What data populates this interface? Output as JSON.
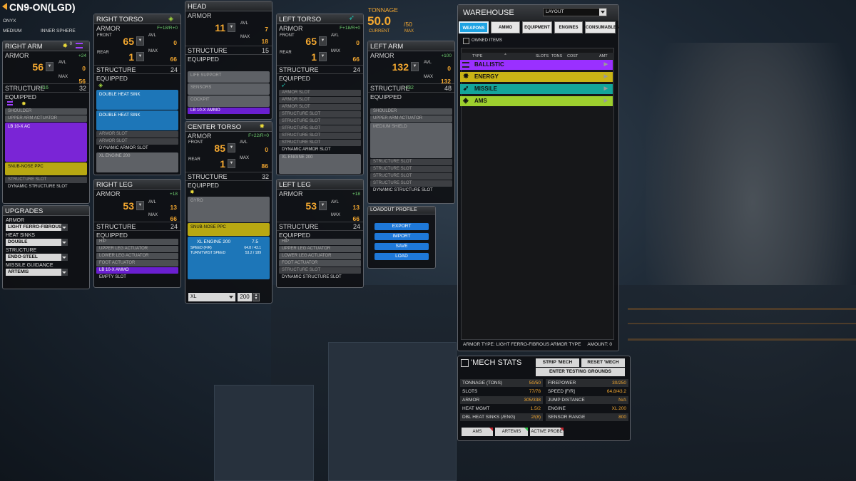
{
  "mech": {
    "name": "CN9-ON(LGD)",
    "variant": "ONYX",
    "weight_class": "MEDIUM",
    "faction": "INNER SPHERE"
  },
  "tonnage": {
    "label": "TONNAGE",
    "current": "50.0",
    "max": "/50",
    "current_label": "CURRENT",
    "max_label": "MAX"
  },
  "labels": {
    "armor": "ARMOR",
    "avl": "AVL",
    "max": "MAX",
    "structure": "STRUCTURE",
    "equipped": "EQUIPPED",
    "front": "FRONT",
    "rear": "REAR"
  },
  "right_arm": {
    "title": "RIGHT ARM",
    "armor": "56",
    "avl": "0",
    "max": "56",
    "tag": "+24",
    "structure": "32",
    "structure_tag": "+16",
    "hardpoints": "0",
    "items": [
      "SHOULDER",
      "UPPER ARM ACTUATOR",
      "LB 10-X AC",
      "SNUB-NOSE PPC",
      "STRUCTURE SLOT",
      "DYNAMIC STRUCTURE SLOT"
    ]
  },
  "right_torso": {
    "title": "RIGHT TORSO",
    "tag": "F+18/R+0",
    "front": "65",
    "avl_front": "0",
    "rear": "1",
    "avl_rear": "66",
    "max_rear": "66",
    "structure": "24",
    "items": [
      "DOUBLE HEAT SINK",
      "DOUBLE HEAT SINK",
      "ARMOR SLOT",
      "ARMOR SLOT",
      "DYNAMIC ARMOR SLOT",
      "XL ENGINE 200"
    ]
  },
  "head": {
    "title": "HEAD",
    "armor": "11",
    "avl": "7",
    "max": "18",
    "structure": "15",
    "items": [
      "LIFE SUPPORT",
      "SENSORS",
      "COCKPIT",
      "LB 10-X AMMO"
    ]
  },
  "center_torso": {
    "title": "CENTER TORSO",
    "tag": "F+22/R+0",
    "front": "85",
    "avl_front": "0",
    "rear": "1",
    "avl_rear": "86",
    "structure": "32",
    "items": [
      "GYRO",
      "SNUB-NOSE PPC"
    ],
    "engine": {
      "name": "XL ENGINE 200",
      "heat": "7.5",
      "speed_label": "SPEED (F/R)",
      "speed": "64.8 / 43.1",
      "turn_label": "TURN/TWIST SPEED",
      "turn": "53.2 / 189"
    },
    "engine_type": "XL",
    "engine_rating": "200"
  },
  "left_torso": {
    "title": "LEFT TORSO",
    "tag": "F+18/R+0",
    "front": "65",
    "avl_front": "0",
    "rear": "1",
    "avl_rear": "66",
    "structure": "24",
    "items": [
      "ARMOR SLOT",
      "ARMOR SLOT",
      "ARMOR SLOT",
      "STRUCTURE SLOT",
      "STRUCTURE SLOT",
      "STRUCTURE SLOT",
      "STRUCTURE SLOT",
      "STRUCTURE SLOT",
      "DYNAMIC ARMOR SLOT",
      "XL ENGINE 200"
    ]
  },
  "left_arm": {
    "title": "LEFT ARM",
    "armor": "132",
    "avl": "0",
    "max": "132",
    "tag": "+100",
    "structure": "48",
    "structure_tag": "+32",
    "items": [
      "SHOULDER",
      "UPPER ARM ACTUATOR",
      "MEDIUM SHIELD",
      "STRUCTURE SLOT",
      "STRUCTURE SLOT",
      "STRUCTURE SLOT",
      "STRUCTURE SLOT",
      "DYNAMIC STRUCTURE SLOT"
    ]
  },
  "right_leg": {
    "title": "RIGHT LEG",
    "armor": "53",
    "avl": "13",
    "max": "66",
    "tag": "+18",
    "structure": "24",
    "items": [
      "HIP",
      "UPPER LEG ACTUATOR",
      "LOWER LEG ACTUATOR",
      "FOOT ACTUATOR",
      "LB 10-X AMMO",
      "EMPTY SLOT"
    ]
  },
  "left_leg": {
    "title": "LEFT LEG",
    "armor": "53",
    "avl": "13",
    "max": "66",
    "tag": "+18",
    "structure": "24",
    "items": [
      "HIP",
      "UPPER LEG ACTUATOR",
      "LOWER LEG ACTUATOR",
      "FOOT ACTUATOR",
      "STRUCTURE SLOT",
      "DYNAMIC STRUCTURE SLOT"
    ]
  },
  "upgrades": {
    "title": "UPGRADES",
    "armor_label": "ARMOR",
    "armor": "LIGHT FERRO-FIBROUS",
    "heat_label": "HEAT SINKS",
    "heat": "DOUBLE",
    "structure_label": "STRUCTURE",
    "structure": "ENDO-STEEL",
    "guidance_label": "MISSILE GUIDANCE",
    "guidance": "ARTEMIS"
  },
  "loadout": {
    "title": "LOADOUT PROFILE",
    "export": "EXPORT",
    "import": "IMPORT",
    "save": "SAVE",
    "load": "LOAD"
  },
  "warehouse": {
    "title": "WAREHOUSE",
    "layout": "LAYOUT",
    "tabs": [
      "WEAPONS",
      "AMMO",
      "EQUIPMENT",
      "ENGINES",
      "CONSUMABLES"
    ],
    "owned": "OWNED ITEMS",
    "cols": [
      "TYPE",
      "SLOTS",
      "TONS",
      "COST",
      "AMT"
    ],
    "rows": [
      {
        "label": "BALLISTIC",
        "color": "#9a30ff"
      },
      {
        "label": "ENERGY",
        "color": "#c9b416"
      },
      {
        "label": "MISSILE",
        "color": "#14a59a"
      },
      {
        "label": "AMS",
        "color": "#9dcf2e"
      }
    ],
    "footer_left": "ARMOR TYPE: LIGHT FERRO-FIBROUS ARMOR TYPE",
    "footer_right": "AMOUNT: 0"
  },
  "stats": {
    "title": "'MECH STATS",
    "strip": "STRIP 'MECH",
    "reset": "RESET 'MECH",
    "testing": "ENTER TESTING GROUNDS",
    "left": [
      {
        "k": "TONNAGE (TONS)",
        "v": "50/50"
      },
      {
        "k": "SLOTS",
        "v": "77/78"
      },
      {
        "k": "ARMOR",
        "v": "305/338"
      },
      {
        "k": "HEAT MGMT",
        "v": "1.5/2"
      },
      {
        "k": "DBL HEAT SINKS (/ENG)",
        "v": "2/(8)"
      }
    ],
    "right": [
      {
        "k": "FIREPOWER",
        "v": "30/250"
      },
      {
        "k": "SPEED [F/R]",
        "v": "64.8/43.2"
      },
      {
        "k": "JUMP DISTANCE",
        "v": "N/A"
      },
      {
        "k": "ENGINE",
        "v": "XL 200"
      },
      {
        "k": "SENSOR RANGE",
        "v": "800"
      }
    ],
    "badges": [
      "AMS",
      "ARTEMIS",
      "ACTIVE PROBE"
    ]
  }
}
